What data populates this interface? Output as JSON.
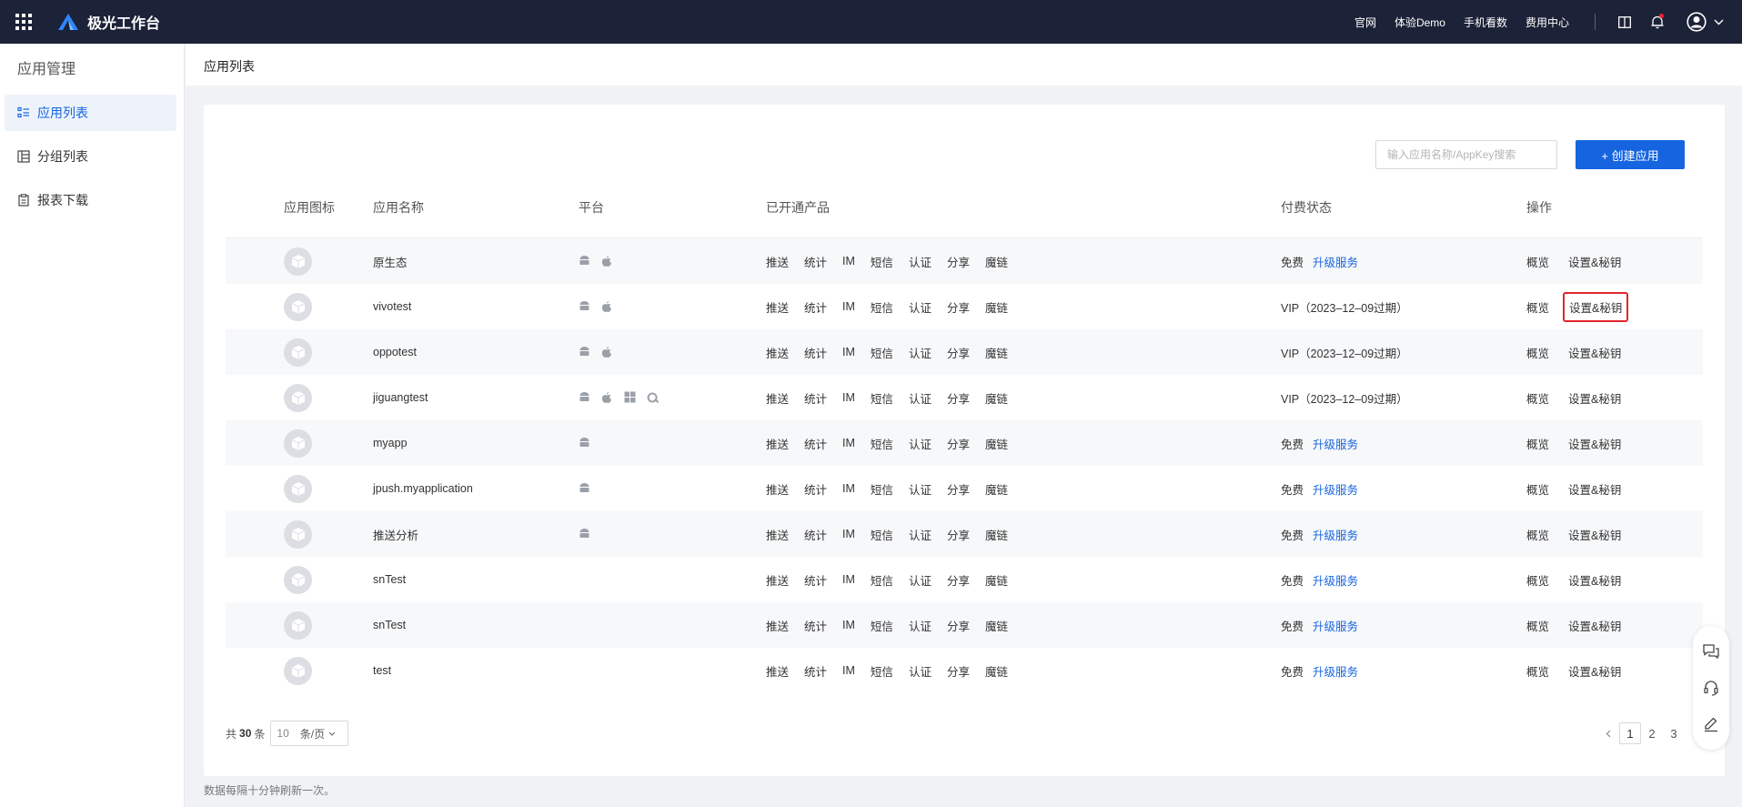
{
  "topbar": {
    "brand": "极光工作台",
    "links": [
      "官网",
      "体验Demo",
      "手机看数",
      "费用中心"
    ]
  },
  "sidebar": {
    "title": "应用管理",
    "items": [
      {
        "label": "应用列表",
        "icon": "list-icon",
        "active": true
      },
      {
        "label": "分组列表",
        "icon": "table-icon",
        "active": false
      },
      {
        "label": "报表下载",
        "icon": "report-icon",
        "active": false
      }
    ]
  },
  "page": {
    "title": "应用列表"
  },
  "toolbar": {
    "search_placeholder": "输入应用名称/AppKey搜索",
    "create_label": "+ 创建应用"
  },
  "table": {
    "headers": [
      "应用图标",
      "应用名称",
      "平台",
      "已开通产品",
      "付费状态",
      "操作"
    ],
    "products": [
      "推送",
      "统计",
      "IM",
      "短信",
      "认证",
      "分享",
      "魔链"
    ],
    "rows": [
      {
        "name": "原生态",
        "platforms": [
          "android",
          "apple"
        ],
        "pay": "免费",
        "upgrade": "升级服务"
      },
      {
        "name": "vivotest",
        "platforms": [
          "android",
          "apple"
        ],
        "pay": "VIP（2023–12–09过期）",
        "upgrade": ""
      },
      {
        "name": "oppotest",
        "platforms": [
          "android",
          "apple"
        ],
        "pay": "VIP（2023–12–09过期）",
        "upgrade": ""
      },
      {
        "name": "jiguangtest",
        "platforms": [
          "android",
          "apple",
          "windows",
          "quickapp"
        ],
        "pay": "VIP（2023–12–09过期）",
        "upgrade": ""
      },
      {
        "name": "myapp",
        "platforms": [
          "android"
        ],
        "pay": "免费",
        "upgrade": "升级服务"
      },
      {
        "name": "jpush.myapplication",
        "platforms": [
          "android"
        ],
        "pay": "免费",
        "upgrade": "升级服务"
      },
      {
        "name": "推送分析",
        "platforms": [
          "android"
        ],
        "pay": "免费",
        "upgrade": "升级服务"
      },
      {
        "name": "snTest",
        "platforms": [],
        "pay": "免费",
        "upgrade": "升级服务"
      },
      {
        "name": "snTest",
        "platforms": [],
        "pay": "免费",
        "upgrade": "升级服务"
      },
      {
        "name": "test",
        "platforms": [],
        "pay": "免费",
        "upgrade": "升级服务"
      }
    ],
    "op_overview": "概览",
    "op_settings": "设置&秘钥"
  },
  "pagination": {
    "total_prefix": "共",
    "total": "30",
    "total_suffix": "条",
    "page_size": "10",
    "page_size_suffix": "条/页",
    "pages": [
      "1",
      "2",
      "3"
    ],
    "current_page": "1"
  },
  "footer_note": "数据每隔十分钟刷新一次。",
  "colors": {
    "topbar": "#1c2238",
    "primary": "#1664e0",
    "highlight": "#e0252b"
  }
}
